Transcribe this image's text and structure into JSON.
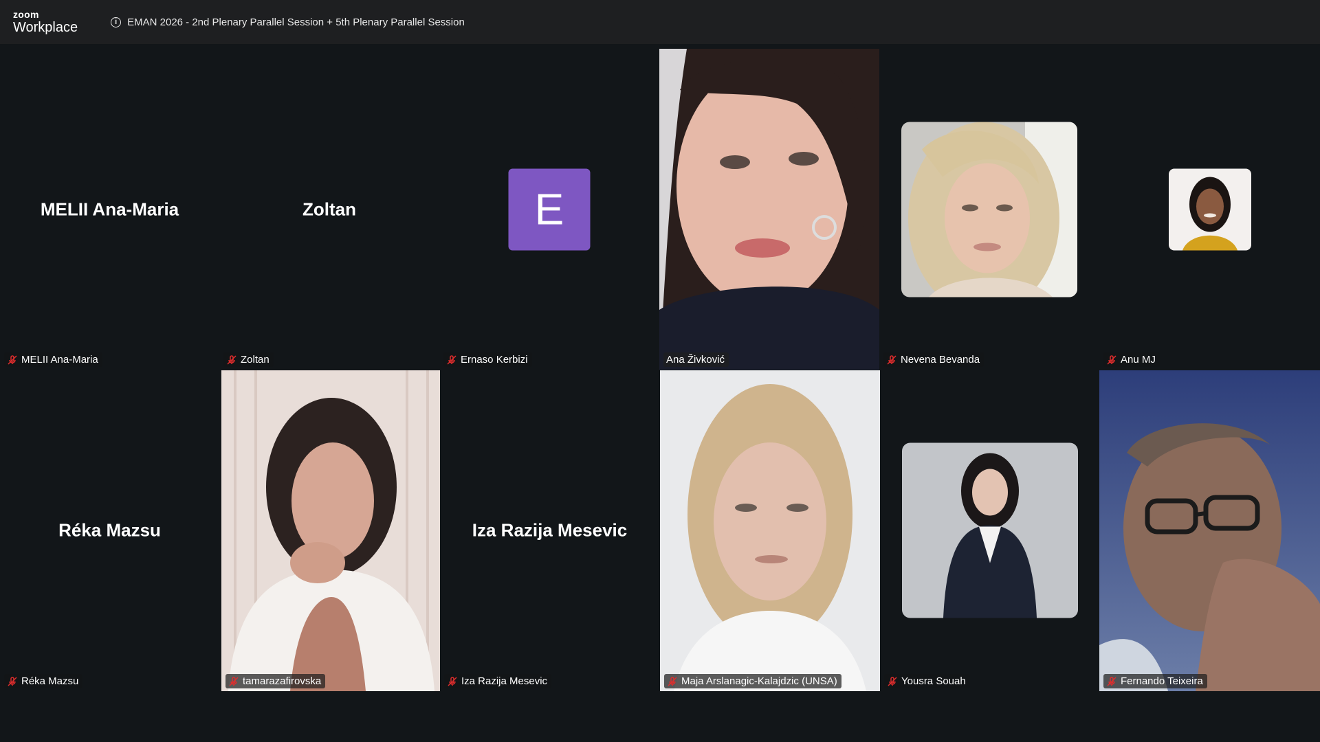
{
  "app": {
    "logo_small": "zoom",
    "logo_big": "Workplace"
  },
  "meeting": {
    "title": "EMAN 2026 - 2nd Plenary Parallel Session + 5th Plenary Parallel Session",
    "info_icon": "i"
  },
  "colors": {
    "active_speaker": "#27d17f",
    "avatar_purple": "#7e57c2",
    "muted_red": "#e02d2d"
  },
  "participants": [
    {
      "name": "MELII Ana-Maria",
      "display": "MELII Ana-Maria",
      "mode": "name",
      "muted": true
    },
    {
      "name": "Zoltan",
      "display": "Zoltan",
      "mode": "name",
      "muted": true
    },
    {
      "name": "Ernaso Kerbizi",
      "letter": "E",
      "mode": "letter-avatar",
      "muted": true
    },
    {
      "name": "Ana Živković",
      "mode": "video",
      "muted": false,
      "active": true
    },
    {
      "name": "Nevena Bevanda",
      "mode": "photo-avatar",
      "muted": true
    },
    {
      "name": "Anu MJ",
      "mode": "photo-avatar",
      "muted": true
    },
    {
      "name": "Réka Mazsu",
      "display": "Réka Mazsu",
      "mode": "name",
      "muted": true
    },
    {
      "name": "tamarazafirovska",
      "mode": "video",
      "muted": true
    },
    {
      "name": "Iza Razija Mesevic",
      "display": "Iza Razija Mesevic",
      "mode": "name",
      "muted": true
    },
    {
      "name": "Maja Arslanagic-Kalajdzic (UNSA)",
      "mode": "video",
      "muted": true
    },
    {
      "name": "Yousra Souah",
      "mode": "photo-avatar",
      "muted": true
    },
    {
      "name": "Fernando Teixeira",
      "mode": "video",
      "muted": true
    }
  ]
}
